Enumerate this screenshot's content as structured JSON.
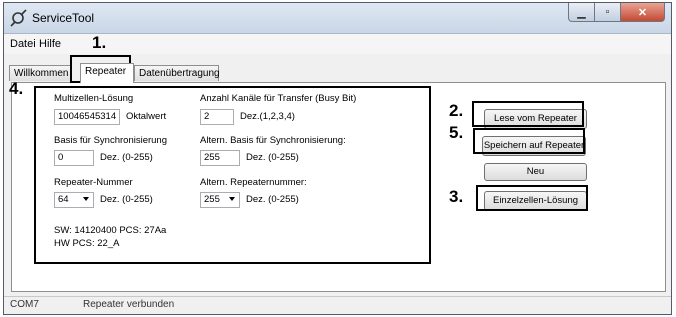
{
  "window": {
    "title": "ServiceTool"
  },
  "menu": {
    "file": "Datei",
    "help": "Hilfe"
  },
  "tabs": [
    {
      "label": "Willkommen"
    },
    {
      "label": "Repeater"
    },
    {
      "label": "Datenübertragung"
    }
  ],
  "callouts": {
    "c1": "1.",
    "c2": "2.",
    "c3": "3.",
    "c4": "4.",
    "c5": "5."
  },
  "left": {
    "multicell_label": "Multizellen-Lösung",
    "multicell_value": "10046545314",
    "multicell_unit": "Oktalwert",
    "sync_label": "Basis für Synchronisierung",
    "sync_value": "0",
    "sync_unit": "Dez. (0-255)",
    "repnum_label": "Repeater-Nummer",
    "repnum_value": "64",
    "repnum_unit": "Dez. (0-255)",
    "sw_info": "SW: 14120400 PCS: 27Aa",
    "hw_info": "HW PCS: 22_A"
  },
  "right": {
    "channels_label": "Anzahl Kanäle für Transfer (Busy Bit)",
    "channels_value": "2",
    "channels_unit": "Dez.(1,2,3,4)",
    "altsync_label": "Altern. Basis für Synchronisierung:",
    "altsync_value": "255",
    "altsync_unit": "Dez. (0-255)",
    "altrep_label": "Altern. Repeaternummer:",
    "altrep_value": "255",
    "altrep_unit": "Dez. (0-255)"
  },
  "buttons": {
    "read": "Lese vom Repeater",
    "save": "Speichern auf Repeater",
    "new": "Neu",
    "single": "Einzelzellen-Lösung"
  },
  "status": {
    "port": "COM7",
    "message": "Repeater verbunden"
  }
}
